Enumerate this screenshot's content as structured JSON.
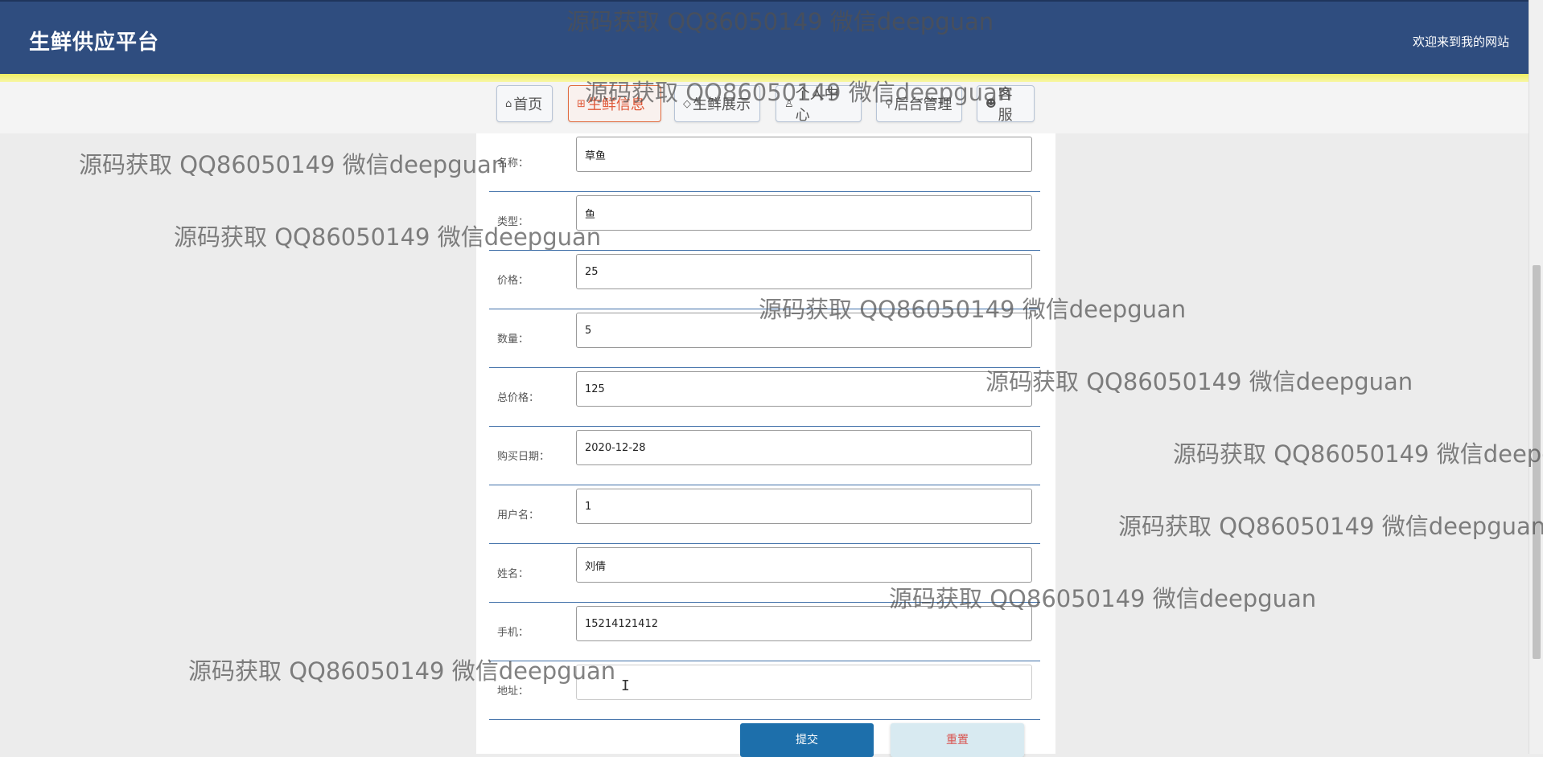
{
  "header": {
    "title": "生鲜供应平台",
    "welcome": "欢迎来到我的网站"
  },
  "nav": [
    {
      "icon": "⌂",
      "label": "首页"
    },
    {
      "icon": "⊞",
      "label": "生鲜信息"
    },
    {
      "icon": "◇",
      "label": "生鲜展示"
    },
    {
      "icon": "♙",
      "label": "个人中心"
    },
    {
      "icon": "⚲",
      "label": "后台管理"
    },
    {
      "icon": "☻",
      "label": "客服"
    }
  ],
  "form": {
    "fields": [
      {
        "label": "名称：",
        "value": "草鱼"
      },
      {
        "label": "类型：",
        "value": "鱼"
      },
      {
        "label": "价格：",
        "value": "25"
      },
      {
        "label": "数量：",
        "value": "5"
      },
      {
        "label": "总价格：",
        "value": "125"
      },
      {
        "label": "购买日期：",
        "value": "2020-12-28"
      },
      {
        "label": "用户名：",
        "value": "1"
      },
      {
        "label": "姓名：",
        "value": "刘倩"
      },
      {
        "label": "手机：",
        "value": "15214121412"
      },
      {
        "label": "地址：",
        "value": ""
      }
    ],
    "submit_label": "提交",
    "reset_label": "重置"
  },
  "watermark": "源码获取 QQ86050149 微信deepguan",
  "colors": {
    "header": "#2f4d7f",
    "accent_bar": "#f0ef63",
    "submit": "#1d6fab",
    "reset_text": "#d9534f"
  }
}
